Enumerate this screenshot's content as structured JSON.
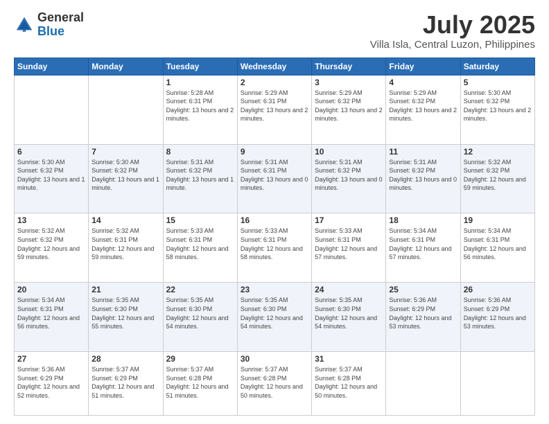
{
  "logo": {
    "general": "General",
    "blue": "Blue"
  },
  "header": {
    "month": "July 2025",
    "location": "Villa Isla, Central Luzon, Philippines"
  },
  "weekdays": [
    "Sunday",
    "Monday",
    "Tuesday",
    "Wednesday",
    "Thursday",
    "Friday",
    "Saturday"
  ],
  "weeks": [
    [
      {
        "day": "",
        "sunrise": "",
        "sunset": "",
        "daylight": ""
      },
      {
        "day": "",
        "sunrise": "",
        "sunset": "",
        "daylight": ""
      },
      {
        "day": "1",
        "sunrise": "Sunrise: 5:28 AM",
        "sunset": "Sunset: 6:31 PM",
        "daylight": "Daylight: 13 hours and 2 minutes."
      },
      {
        "day": "2",
        "sunrise": "Sunrise: 5:29 AM",
        "sunset": "Sunset: 6:31 PM",
        "daylight": "Daylight: 13 hours and 2 minutes."
      },
      {
        "day": "3",
        "sunrise": "Sunrise: 5:29 AM",
        "sunset": "Sunset: 6:32 PM",
        "daylight": "Daylight: 13 hours and 2 minutes."
      },
      {
        "day": "4",
        "sunrise": "Sunrise: 5:29 AM",
        "sunset": "Sunset: 6:32 PM",
        "daylight": "Daylight: 13 hours and 2 minutes."
      },
      {
        "day": "5",
        "sunrise": "Sunrise: 5:30 AM",
        "sunset": "Sunset: 6:32 PM",
        "daylight": "Daylight: 13 hours and 2 minutes."
      }
    ],
    [
      {
        "day": "6",
        "sunrise": "Sunrise: 5:30 AM",
        "sunset": "Sunset: 6:32 PM",
        "daylight": "Daylight: 13 hours and 1 minute."
      },
      {
        "day": "7",
        "sunrise": "Sunrise: 5:30 AM",
        "sunset": "Sunset: 6:32 PM",
        "daylight": "Daylight: 13 hours and 1 minute."
      },
      {
        "day": "8",
        "sunrise": "Sunrise: 5:31 AM",
        "sunset": "Sunset: 6:32 PM",
        "daylight": "Daylight: 13 hours and 1 minute."
      },
      {
        "day": "9",
        "sunrise": "Sunrise: 5:31 AM",
        "sunset": "Sunset: 6:31 PM",
        "daylight": "Daylight: 13 hours and 0 minutes."
      },
      {
        "day": "10",
        "sunrise": "Sunrise: 5:31 AM",
        "sunset": "Sunset: 6:32 PM",
        "daylight": "Daylight: 13 hours and 0 minutes."
      },
      {
        "day": "11",
        "sunrise": "Sunrise: 5:31 AM",
        "sunset": "Sunset: 6:32 PM",
        "daylight": "Daylight: 13 hours and 0 minutes."
      },
      {
        "day": "12",
        "sunrise": "Sunrise: 5:32 AM",
        "sunset": "Sunset: 6:32 PM",
        "daylight": "Daylight: 12 hours and 59 minutes."
      }
    ],
    [
      {
        "day": "13",
        "sunrise": "Sunrise: 5:32 AM",
        "sunset": "Sunset: 6:32 PM",
        "daylight": "Daylight: 12 hours and 59 minutes."
      },
      {
        "day": "14",
        "sunrise": "Sunrise: 5:32 AM",
        "sunset": "Sunset: 6:31 PM",
        "daylight": "Daylight: 12 hours and 59 minutes."
      },
      {
        "day": "15",
        "sunrise": "Sunrise: 5:33 AM",
        "sunset": "Sunset: 6:31 PM",
        "daylight": "Daylight: 12 hours and 58 minutes."
      },
      {
        "day": "16",
        "sunrise": "Sunrise: 5:33 AM",
        "sunset": "Sunset: 6:31 PM",
        "daylight": "Daylight: 12 hours and 58 minutes."
      },
      {
        "day": "17",
        "sunrise": "Sunrise: 5:33 AM",
        "sunset": "Sunset: 6:31 PM",
        "daylight": "Daylight: 12 hours and 57 minutes."
      },
      {
        "day": "18",
        "sunrise": "Sunrise: 5:34 AM",
        "sunset": "Sunset: 6:31 PM",
        "daylight": "Daylight: 12 hours and 57 minutes."
      },
      {
        "day": "19",
        "sunrise": "Sunrise: 5:34 AM",
        "sunset": "Sunset: 6:31 PM",
        "daylight": "Daylight: 12 hours and 56 minutes."
      }
    ],
    [
      {
        "day": "20",
        "sunrise": "Sunrise: 5:34 AM",
        "sunset": "Sunset: 6:31 PM",
        "daylight": "Daylight: 12 hours and 56 minutes."
      },
      {
        "day": "21",
        "sunrise": "Sunrise: 5:35 AM",
        "sunset": "Sunset: 6:30 PM",
        "daylight": "Daylight: 12 hours and 55 minutes."
      },
      {
        "day": "22",
        "sunrise": "Sunrise: 5:35 AM",
        "sunset": "Sunset: 6:30 PM",
        "daylight": "Daylight: 12 hours and 54 minutes."
      },
      {
        "day": "23",
        "sunrise": "Sunrise: 5:35 AM",
        "sunset": "Sunset: 6:30 PM",
        "daylight": "Daylight: 12 hours and 54 minutes."
      },
      {
        "day": "24",
        "sunrise": "Sunrise: 5:35 AM",
        "sunset": "Sunset: 6:30 PM",
        "daylight": "Daylight: 12 hours and 54 minutes."
      },
      {
        "day": "25",
        "sunrise": "Sunrise: 5:36 AM",
        "sunset": "Sunset: 6:29 PM",
        "daylight": "Daylight: 12 hours and 53 minutes."
      },
      {
        "day": "26",
        "sunrise": "Sunrise: 5:36 AM",
        "sunset": "Sunset: 6:29 PM",
        "daylight": "Daylight: 12 hours and 53 minutes."
      }
    ],
    [
      {
        "day": "27",
        "sunrise": "Sunrise: 5:36 AM",
        "sunset": "Sunset: 6:29 PM",
        "daylight": "Daylight: 12 hours and 52 minutes."
      },
      {
        "day": "28",
        "sunrise": "Sunrise: 5:37 AM",
        "sunset": "Sunset: 6:29 PM",
        "daylight": "Daylight: 12 hours and 51 minutes."
      },
      {
        "day": "29",
        "sunrise": "Sunrise: 5:37 AM",
        "sunset": "Sunset: 6:28 PM",
        "daylight": "Daylight: 12 hours and 51 minutes."
      },
      {
        "day": "30",
        "sunrise": "Sunrise: 5:37 AM",
        "sunset": "Sunset: 6:28 PM",
        "daylight": "Daylight: 12 hours and 50 minutes."
      },
      {
        "day": "31",
        "sunrise": "Sunrise: 5:37 AM",
        "sunset": "Sunset: 6:28 PM",
        "daylight": "Daylight: 12 hours and 50 minutes."
      },
      {
        "day": "",
        "sunrise": "",
        "sunset": "",
        "daylight": ""
      },
      {
        "day": "",
        "sunrise": "",
        "sunset": "",
        "daylight": ""
      }
    ]
  ]
}
